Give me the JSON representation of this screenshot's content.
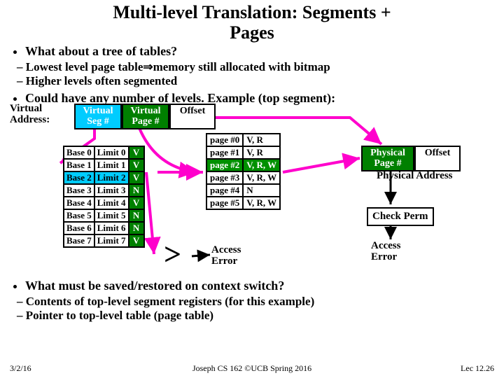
{
  "title_l1": "Multi-level Translation: Segments +",
  "title_l2": "Pages",
  "bullets": {
    "b1": "What about a tree of tables?",
    "b1s1": "Lowest level page table⇒memory still allocated with bitmap",
    "b1s2": "Higher levels often segmented",
    "b2": "Could have any number of levels. Example (top segment):",
    "b3": "What must be saved/restored on context switch?",
    "b3s1": "Contents of top-level segment registers (for this example)",
    "b3s2": "Pointer to top-level table (page table)"
  },
  "vaddr_label": "Virtual\nAddress:",
  "vaddr": {
    "seg_l1": "Virtual",
    "seg_l2": "Seg #",
    "pg_l1": "Virtual",
    "pg_l2": "Page #",
    "off": "Offset"
  },
  "segtable": [
    {
      "b": "Base 0",
      "l": "Limit 0",
      "v": "V"
    },
    {
      "b": "Base 1",
      "l": "Limit 1",
      "v": "V"
    },
    {
      "b": "Base 2",
      "l": "Limit 2",
      "v": "V"
    },
    {
      "b": "Base 3",
      "l": "Limit 3",
      "v": "N"
    },
    {
      "b": "Base 4",
      "l": "Limit 4",
      "v": "V"
    },
    {
      "b": "Base 5",
      "l": "Limit 5",
      "v": "N"
    },
    {
      "b": "Base 6",
      "l": "Limit 6",
      "v": "N"
    },
    {
      "b": "Base 7",
      "l": "Limit 7",
      "v": "V"
    }
  ],
  "pagetable": [
    {
      "p": "page #0",
      "f": "V, R"
    },
    {
      "p": "page #1",
      "f": "V, R"
    },
    {
      "p": "page #2",
      "f": "V, R, W"
    },
    {
      "p": "page #3",
      "f": "V, R, W"
    },
    {
      "p": "page #4",
      "f": "N"
    },
    {
      "p": "page #5",
      "f": "V, R, W"
    }
  ],
  "gt": ">",
  "paddr": {
    "pg_l1": "Physical",
    "pg_l2": "Page #",
    "off": "Offset",
    "lbl": "Physical Address"
  },
  "check": "Check Perm",
  "aerr1": "Access\nError",
  "aerr2": "Access\nError",
  "footer": {
    "date": "3/2/16",
    "center": "Joseph CS 162 ©UCB Spring 2016",
    "right": "Lec 12.26"
  }
}
